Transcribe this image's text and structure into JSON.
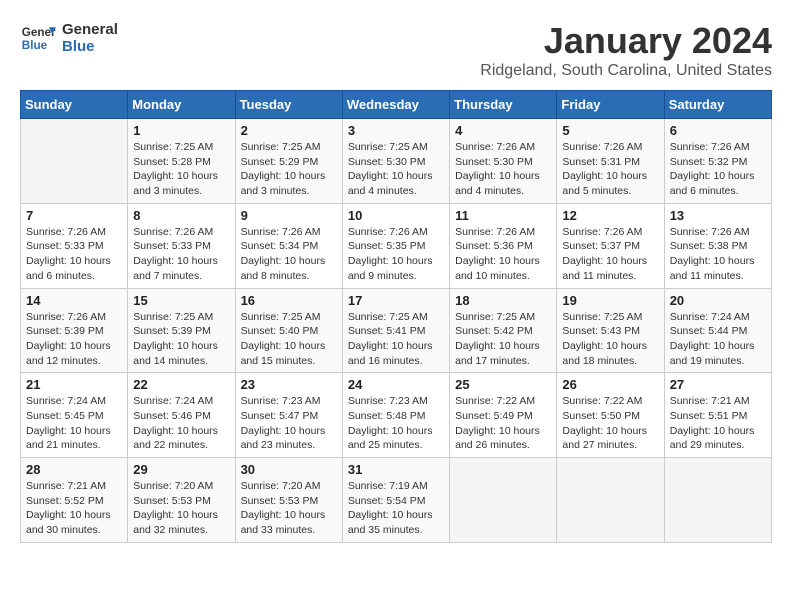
{
  "header": {
    "logo_text_general": "General",
    "logo_text_blue": "Blue",
    "title": "January 2024",
    "subtitle": "Ridgeland, South Carolina, United States"
  },
  "calendar": {
    "headers": [
      "Sunday",
      "Monday",
      "Tuesday",
      "Wednesday",
      "Thursday",
      "Friday",
      "Saturday"
    ],
    "weeks": [
      [
        {
          "day": "",
          "info": ""
        },
        {
          "day": "1",
          "info": "Sunrise: 7:25 AM\nSunset: 5:28 PM\nDaylight: 10 hours\nand 3 minutes."
        },
        {
          "day": "2",
          "info": "Sunrise: 7:25 AM\nSunset: 5:29 PM\nDaylight: 10 hours\nand 3 minutes."
        },
        {
          "day": "3",
          "info": "Sunrise: 7:25 AM\nSunset: 5:30 PM\nDaylight: 10 hours\nand 4 minutes."
        },
        {
          "day": "4",
          "info": "Sunrise: 7:26 AM\nSunset: 5:30 PM\nDaylight: 10 hours\nand 4 minutes."
        },
        {
          "day": "5",
          "info": "Sunrise: 7:26 AM\nSunset: 5:31 PM\nDaylight: 10 hours\nand 5 minutes."
        },
        {
          "day": "6",
          "info": "Sunrise: 7:26 AM\nSunset: 5:32 PM\nDaylight: 10 hours\nand 6 minutes."
        }
      ],
      [
        {
          "day": "7",
          "info": "Sunrise: 7:26 AM\nSunset: 5:33 PM\nDaylight: 10 hours\nand 6 minutes."
        },
        {
          "day": "8",
          "info": "Sunrise: 7:26 AM\nSunset: 5:33 PM\nDaylight: 10 hours\nand 7 minutes."
        },
        {
          "day": "9",
          "info": "Sunrise: 7:26 AM\nSunset: 5:34 PM\nDaylight: 10 hours\nand 8 minutes."
        },
        {
          "day": "10",
          "info": "Sunrise: 7:26 AM\nSunset: 5:35 PM\nDaylight: 10 hours\nand 9 minutes."
        },
        {
          "day": "11",
          "info": "Sunrise: 7:26 AM\nSunset: 5:36 PM\nDaylight: 10 hours\nand 10 minutes."
        },
        {
          "day": "12",
          "info": "Sunrise: 7:26 AM\nSunset: 5:37 PM\nDaylight: 10 hours\nand 11 minutes."
        },
        {
          "day": "13",
          "info": "Sunrise: 7:26 AM\nSunset: 5:38 PM\nDaylight: 10 hours\nand 11 minutes."
        }
      ],
      [
        {
          "day": "14",
          "info": "Sunrise: 7:26 AM\nSunset: 5:39 PM\nDaylight: 10 hours\nand 12 minutes."
        },
        {
          "day": "15",
          "info": "Sunrise: 7:25 AM\nSunset: 5:39 PM\nDaylight: 10 hours\nand 14 minutes."
        },
        {
          "day": "16",
          "info": "Sunrise: 7:25 AM\nSunset: 5:40 PM\nDaylight: 10 hours\nand 15 minutes."
        },
        {
          "day": "17",
          "info": "Sunrise: 7:25 AM\nSunset: 5:41 PM\nDaylight: 10 hours\nand 16 minutes."
        },
        {
          "day": "18",
          "info": "Sunrise: 7:25 AM\nSunset: 5:42 PM\nDaylight: 10 hours\nand 17 minutes."
        },
        {
          "day": "19",
          "info": "Sunrise: 7:25 AM\nSunset: 5:43 PM\nDaylight: 10 hours\nand 18 minutes."
        },
        {
          "day": "20",
          "info": "Sunrise: 7:24 AM\nSunset: 5:44 PM\nDaylight: 10 hours\nand 19 minutes."
        }
      ],
      [
        {
          "day": "21",
          "info": "Sunrise: 7:24 AM\nSunset: 5:45 PM\nDaylight: 10 hours\nand 21 minutes."
        },
        {
          "day": "22",
          "info": "Sunrise: 7:24 AM\nSunset: 5:46 PM\nDaylight: 10 hours\nand 22 minutes."
        },
        {
          "day": "23",
          "info": "Sunrise: 7:23 AM\nSunset: 5:47 PM\nDaylight: 10 hours\nand 23 minutes."
        },
        {
          "day": "24",
          "info": "Sunrise: 7:23 AM\nSunset: 5:48 PM\nDaylight: 10 hours\nand 25 minutes."
        },
        {
          "day": "25",
          "info": "Sunrise: 7:22 AM\nSunset: 5:49 PM\nDaylight: 10 hours\nand 26 minutes."
        },
        {
          "day": "26",
          "info": "Sunrise: 7:22 AM\nSunset: 5:50 PM\nDaylight: 10 hours\nand 27 minutes."
        },
        {
          "day": "27",
          "info": "Sunrise: 7:21 AM\nSunset: 5:51 PM\nDaylight: 10 hours\nand 29 minutes."
        }
      ],
      [
        {
          "day": "28",
          "info": "Sunrise: 7:21 AM\nSunset: 5:52 PM\nDaylight: 10 hours\nand 30 minutes."
        },
        {
          "day": "29",
          "info": "Sunrise: 7:20 AM\nSunset: 5:53 PM\nDaylight: 10 hours\nand 32 minutes."
        },
        {
          "day": "30",
          "info": "Sunrise: 7:20 AM\nSunset: 5:53 PM\nDaylight: 10 hours\nand 33 minutes."
        },
        {
          "day": "31",
          "info": "Sunrise: 7:19 AM\nSunset: 5:54 PM\nDaylight: 10 hours\nand 35 minutes."
        },
        {
          "day": "",
          "info": ""
        },
        {
          "day": "",
          "info": ""
        },
        {
          "day": "",
          "info": ""
        }
      ]
    ]
  }
}
